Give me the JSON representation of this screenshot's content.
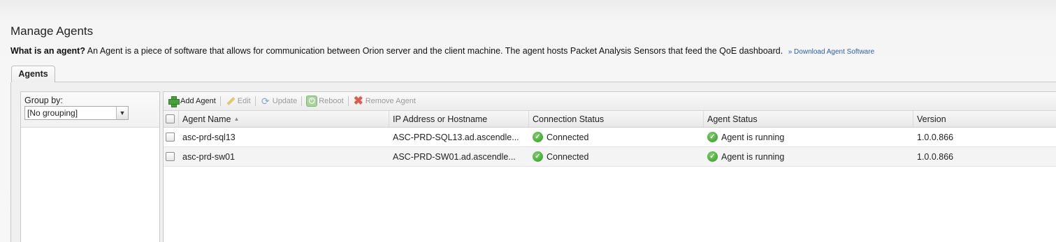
{
  "page": {
    "title": "Manage Agents",
    "intro_bold": "What is an agent?",
    "intro_text": "An Agent is a piece of software that allows for communication between Orion server and the client machine. The agent hosts Packet Analysis Sensors that feed the QoE dashboard.",
    "download_link": "» Download Agent Software"
  },
  "tabs": [
    {
      "label": "Agents"
    }
  ],
  "group_by": {
    "label": "Group by:",
    "selected": "[No grouping]"
  },
  "toolbar": {
    "add": "Add Agent",
    "edit": "Edit",
    "update": "Update",
    "reboot": "Reboot",
    "remove": "Remove Agent"
  },
  "columns": {
    "name": "Agent Name",
    "ip": "IP Address or Hostname",
    "connection": "Connection Status",
    "status": "Agent Status",
    "version": "Version"
  },
  "rows": [
    {
      "name": "asc-prd-sql13",
      "ip": "ASC-PRD-SQL13.ad.ascendle...",
      "connection": "Connected",
      "status": "Agent is running",
      "version": "1.0.0.866"
    },
    {
      "name": "asc-prd-sw01",
      "ip": "ASC-PRD-SW01.ad.ascendle...",
      "connection": "Connected",
      "status": "Agent is running",
      "version": "1.0.0.866"
    }
  ],
  "icons": {
    "add": "plus-icon",
    "edit": "pencil-icon",
    "update": "refresh-icon",
    "reboot": "power-icon",
    "remove": "x-icon",
    "status_ok": "check-circle-icon"
  },
  "colors": {
    "link": "#2a5ea8",
    "ok_green": "#2e9a22",
    "remove_red": "#e05a4a"
  }
}
